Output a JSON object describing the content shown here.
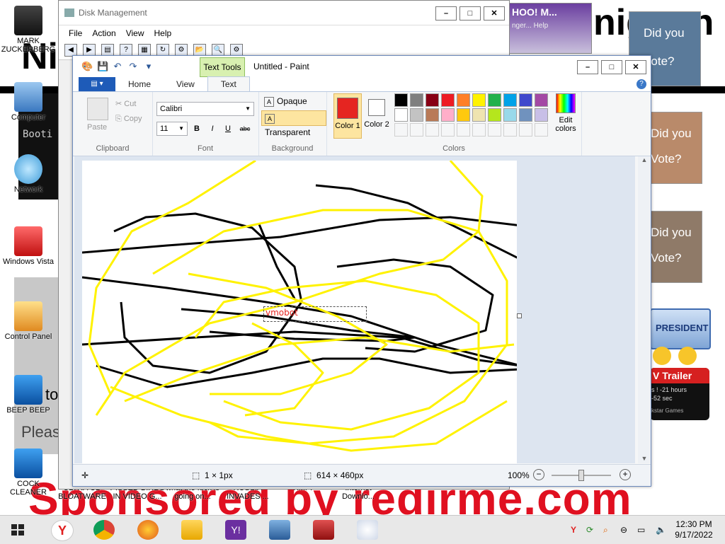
{
  "desktop": {
    "icons": [
      {
        "label": "MARK ZUCKERBERG"
      },
      {
        "label": "Computer"
      },
      {
        "label": "Network"
      },
      {
        "label": "Windows Vista"
      },
      {
        "label": "Control Panel"
      },
      {
        "label": "BEEP BEEP"
      },
      {
        "label": "COCK CLEANER"
      },
      {
        "label": "ULTRA CD BLOATWARE"
      },
      {
        "label": "PISSED BIRDS IN VIDEO G..."
      },
      {
        "label": "what the fuck is going on..."
      },
      {
        "label": "RUSSIA INVADES ..."
      },
      {
        "label": "XMPP"
      },
      {
        "label": "Internet Downlo..."
      }
    ],
    "bg_texts": {
      "sponsor": "Sponsored by redirme.com",
      "did_you_1": "Did you",
      "vote_1": "Vote?",
      "did_you_2": "Did you",
      "vote_2": "Vote?",
      "did_you_3": "Did you",
      "vote_3": "Vote?",
      "president": "PRESIDENT",
      "trailer": "V Trailer",
      "countdown_1": "s ! -21 hours",
      "countdown_2": "-52 sec",
      "games": "kstar Games",
      "please": "Please",
      "to_y": "to y",
      "boot": "Booti",
      "migeon": "nigeon",
      "yahoo": "HOO! M...",
      "yahoo_sub": "nger... Help"
    }
  },
  "disk_management": {
    "title": "Disk Management",
    "menu": [
      "File",
      "Action",
      "View",
      "Help"
    ]
  },
  "paint": {
    "context_tab": "Text Tools",
    "title": "Untitled - Paint",
    "tabs": [
      "Home",
      "View",
      "Text"
    ],
    "active_tab": "Text",
    "clipboard": {
      "paste": "Paste",
      "cut": "Cut",
      "copy": "Copy",
      "label": "Clipboard"
    },
    "font": {
      "family": "Calibri",
      "size": "11",
      "bold": "B",
      "italic": "I",
      "underline": "U",
      "strike": "abc",
      "label": "Font"
    },
    "background": {
      "opaque": "Opaque",
      "transparent": "Transparent",
      "label": "Background"
    },
    "colors": {
      "color1_label": "Color 1",
      "color2_label": "Color 2",
      "edit_colors": "Edit colors",
      "label": "Colors",
      "color1": "#e52521",
      "color2": "#ffffff",
      "palette_row1": [
        "#000000",
        "#7f7f7f",
        "#880015",
        "#ed1c24",
        "#ff7f27",
        "#fff200",
        "#22b14c",
        "#00a2e8",
        "#3f48cc",
        "#a349a4"
      ],
      "palette_row2": [
        "#ffffff",
        "#c3c3c3",
        "#b97a57",
        "#ffaec9",
        "#ffc90e",
        "#efe4b0",
        "#b5e61d",
        "#99d9ea",
        "#7092be",
        "#c8bfe7"
      ]
    },
    "canvas_text": "vmobot",
    "status": {
      "selection": "1 × 1px",
      "size": "614 × 460px",
      "zoom": "100%"
    }
  },
  "taskbar": {
    "time": "12:30 PM",
    "date": "9/17/2022"
  }
}
